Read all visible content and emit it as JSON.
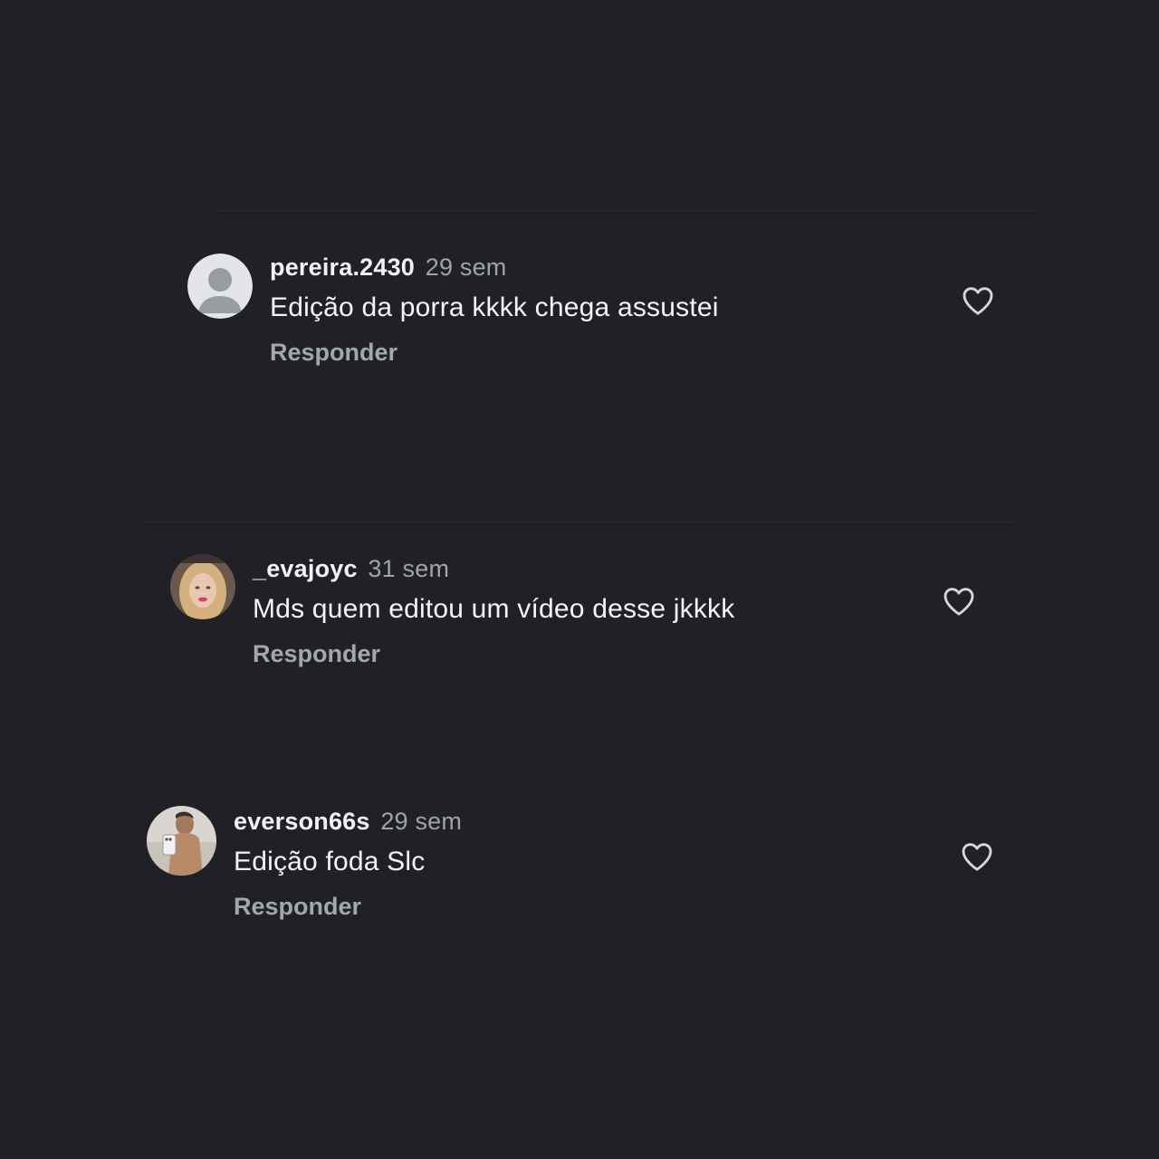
{
  "comments": [
    {
      "username": "pereira.2430",
      "time": "29 sem",
      "text": "Edição da porra kkkk chega assustei",
      "reply_label": "Responder",
      "avatar": "default-person-avatar",
      "like_icon": "heart-outline-icon"
    },
    {
      "username": "_evajoyc",
      "time": "31 sem",
      "text": "Mds quem editou um vídeo desse jkkkk",
      "reply_label": "Responder",
      "avatar": "profile-photo-avatar",
      "like_icon": "heart-outline-icon"
    },
    {
      "username": "everson66s",
      "time": "29 sem",
      "text": "Edição foda Slc",
      "reply_label": "Responder",
      "avatar": "profile-photo-avatar",
      "like_icon": "heart-outline-icon"
    }
  ],
  "colors": {
    "background": "#202127",
    "username": "#f2f2f4",
    "secondary_text": "#a0a3ab",
    "icon": "#d6d7db"
  }
}
